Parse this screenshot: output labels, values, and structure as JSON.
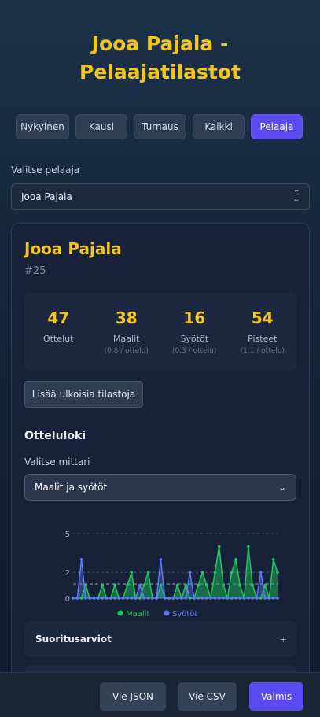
{
  "page": {
    "title_line1": "Jooa Pajala -",
    "title_line2": "Pelaajatilastot"
  },
  "tabs": [
    {
      "label": "Nykyinen"
    },
    {
      "label": "Kausi"
    },
    {
      "label": "Turnaus"
    },
    {
      "label": "Kaikki"
    },
    {
      "label": "Pelaaja",
      "active": true
    }
  ],
  "player_select": {
    "label": "Valitse pelaaja",
    "value": "Jooa Pajala"
  },
  "player": {
    "name": "Jooa Pajala",
    "number": "#25",
    "stats": [
      {
        "value": "47",
        "label": "Ottelut",
        "sub": ""
      },
      {
        "value": "38",
        "label": "Maalit",
        "sub": "(0.8 / ottelu)"
      },
      {
        "value": "16",
        "label": "Syötöt",
        "sub": "(0.3 / ottelu)"
      },
      {
        "value": "54",
        "label": "Pisteet",
        "sub": "(1.1 / ottelu)"
      }
    ],
    "external_button": "Lisää ulkoisia tilastoja"
  },
  "match_log": {
    "heading": "Otteluloki",
    "metric_label": "Valitse mittari",
    "metric_value": "Maalit ja syötöt"
  },
  "chart_data": {
    "type": "area",
    "y_ticks": [
      "5",
      "2",
      "0"
    ],
    "ylim": [
      0,
      5.5
    ],
    "average_line": 1.1,
    "series": [
      {
        "name": "Maalit",
        "color": "#22c55e",
        "values": [
          0,
          0,
          0,
          1,
          0,
          0,
          0,
          1,
          0,
          0,
          1,
          0,
          0,
          1,
          2,
          0,
          0,
          1,
          2,
          0,
          0,
          1,
          0,
          0,
          0,
          1,
          0,
          1,
          0,
          0,
          1,
          2,
          1,
          0,
          2,
          4,
          1,
          0,
          2,
          3,
          1,
          0,
          4,
          1,
          0,
          0,
          1,
          0,
          3,
          2
        ]
      },
      {
        "name": "Syötöt",
        "color": "#5b7cf0",
        "values": [
          0,
          0,
          3,
          0,
          0,
          0,
          0,
          0,
          0,
          0,
          0,
          0,
          0,
          0,
          0,
          0,
          1,
          0,
          0,
          0,
          0,
          3,
          0,
          0,
          0,
          0,
          0,
          0,
          2,
          0,
          0,
          0,
          0,
          0,
          0,
          0,
          0,
          0,
          0,
          0,
          0,
          0,
          0,
          0,
          0,
          2,
          0,
          0,
          0,
          0
        ]
      }
    ]
  },
  "accordion": {
    "title": "Suoritusarviot",
    "toggle": "+"
  },
  "footer": {
    "json": "Vie JSON",
    "csv": "Vie CSV",
    "done": "Valmis"
  },
  "colors": {
    "accent": "#f4c51a",
    "primary": "#5b4af0"
  }
}
